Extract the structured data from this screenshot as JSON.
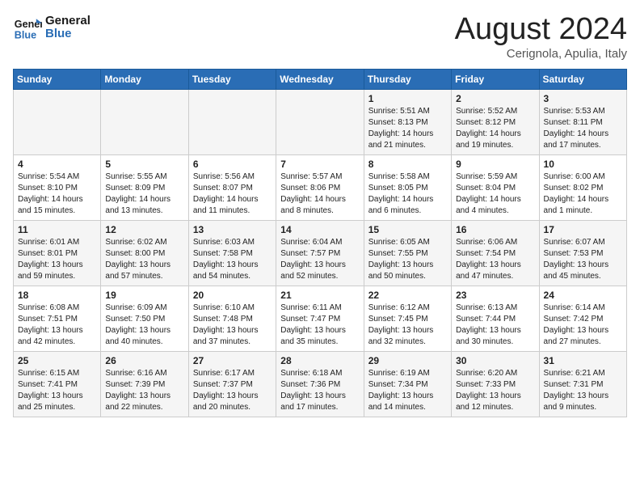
{
  "header": {
    "logo_line1": "General",
    "logo_line2": "Blue",
    "calendar_title": "August 2024",
    "calendar_subtitle": "Cerignola, Apulia, Italy"
  },
  "weekdays": [
    "Sunday",
    "Monday",
    "Tuesday",
    "Wednesday",
    "Thursday",
    "Friday",
    "Saturday"
  ],
  "weeks": [
    [
      {
        "day": "",
        "info": ""
      },
      {
        "day": "",
        "info": ""
      },
      {
        "day": "",
        "info": ""
      },
      {
        "day": "",
        "info": ""
      },
      {
        "day": "1",
        "info": "Sunrise: 5:51 AM\nSunset: 8:13 PM\nDaylight: 14 hours\nand 21 minutes."
      },
      {
        "day": "2",
        "info": "Sunrise: 5:52 AM\nSunset: 8:12 PM\nDaylight: 14 hours\nand 19 minutes."
      },
      {
        "day": "3",
        "info": "Sunrise: 5:53 AM\nSunset: 8:11 PM\nDaylight: 14 hours\nand 17 minutes."
      }
    ],
    [
      {
        "day": "4",
        "info": "Sunrise: 5:54 AM\nSunset: 8:10 PM\nDaylight: 14 hours\nand 15 minutes."
      },
      {
        "day": "5",
        "info": "Sunrise: 5:55 AM\nSunset: 8:09 PM\nDaylight: 14 hours\nand 13 minutes."
      },
      {
        "day": "6",
        "info": "Sunrise: 5:56 AM\nSunset: 8:07 PM\nDaylight: 14 hours\nand 11 minutes."
      },
      {
        "day": "7",
        "info": "Sunrise: 5:57 AM\nSunset: 8:06 PM\nDaylight: 14 hours\nand 8 minutes."
      },
      {
        "day": "8",
        "info": "Sunrise: 5:58 AM\nSunset: 8:05 PM\nDaylight: 14 hours\nand 6 minutes."
      },
      {
        "day": "9",
        "info": "Sunrise: 5:59 AM\nSunset: 8:04 PM\nDaylight: 14 hours\nand 4 minutes."
      },
      {
        "day": "10",
        "info": "Sunrise: 6:00 AM\nSunset: 8:02 PM\nDaylight: 14 hours\nand 1 minute."
      }
    ],
    [
      {
        "day": "11",
        "info": "Sunrise: 6:01 AM\nSunset: 8:01 PM\nDaylight: 13 hours\nand 59 minutes."
      },
      {
        "day": "12",
        "info": "Sunrise: 6:02 AM\nSunset: 8:00 PM\nDaylight: 13 hours\nand 57 minutes."
      },
      {
        "day": "13",
        "info": "Sunrise: 6:03 AM\nSunset: 7:58 PM\nDaylight: 13 hours\nand 54 minutes."
      },
      {
        "day": "14",
        "info": "Sunrise: 6:04 AM\nSunset: 7:57 PM\nDaylight: 13 hours\nand 52 minutes."
      },
      {
        "day": "15",
        "info": "Sunrise: 6:05 AM\nSunset: 7:55 PM\nDaylight: 13 hours\nand 50 minutes."
      },
      {
        "day": "16",
        "info": "Sunrise: 6:06 AM\nSunset: 7:54 PM\nDaylight: 13 hours\nand 47 minutes."
      },
      {
        "day": "17",
        "info": "Sunrise: 6:07 AM\nSunset: 7:53 PM\nDaylight: 13 hours\nand 45 minutes."
      }
    ],
    [
      {
        "day": "18",
        "info": "Sunrise: 6:08 AM\nSunset: 7:51 PM\nDaylight: 13 hours\nand 42 minutes."
      },
      {
        "day": "19",
        "info": "Sunrise: 6:09 AM\nSunset: 7:50 PM\nDaylight: 13 hours\nand 40 minutes."
      },
      {
        "day": "20",
        "info": "Sunrise: 6:10 AM\nSunset: 7:48 PM\nDaylight: 13 hours\nand 37 minutes."
      },
      {
        "day": "21",
        "info": "Sunrise: 6:11 AM\nSunset: 7:47 PM\nDaylight: 13 hours\nand 35 minutes."
      },
      {
        "day": "22",
        "info": "Sunrise: 6:12 AM\nSunset: 7:45 PM\nDaylight: 13 hours\nand 32 minutes."
      },
      {
        "day": "23",
        "info": "Sunrise: 6:13 AM\nSunset: 7:44 PM\nDaylight: 13 hours\nand 30 minutes."
      },
      {
        "day": "24",
        "info": "Sunrise: 6:14 AM\nSunset: 7:42 PM\nDaylight: 13 hours\nand 27 minutes."
      }
    ],
    [
      {
        "day": "25",
        "info": "Sunrise: 6:15 AM\nSunset: 7:41 PM\nDaylight: 13 hours\nand 25 minutes."
      },
      {
        "day": "26",
        "info": "Sunrise: 6:16 AM\nSunset: 7:39 PM\nDaylight: 13 hours\nand 22 minutes."
      },
      {
        "day": "27",
        "info": "Sunrise: 6:17 AM\nSunset: 7:37 PM\nDaylight: 13 hours\nand 20 minutes."
      },
      {
        "day": "28",
        "info": "Sunrise: 6:18 AM\nSunset: 7:36 PM\nDaylight: 13 hours\nand 17 minutes."
      },
      {
        "day": "29",
        "info": "Sunrise: 6:19 AM\nSunset: 7:34 PM\nDaylight: 13 hours\nand 14 minutes."
      },
      {
        "day": "30",
        "info": "Sunrise: 6:20 AM\nSunset: 7:33 PM\nDaylight: 13 hours\nand 12 minutes."
      },
      {
        "day": "31",
        "info": "Sunrise: 6:21 AM\nSunset: 7:31 PM\nDaylight: 13 hours\nand 9 minutes."
      }
    ]
  ]
}
